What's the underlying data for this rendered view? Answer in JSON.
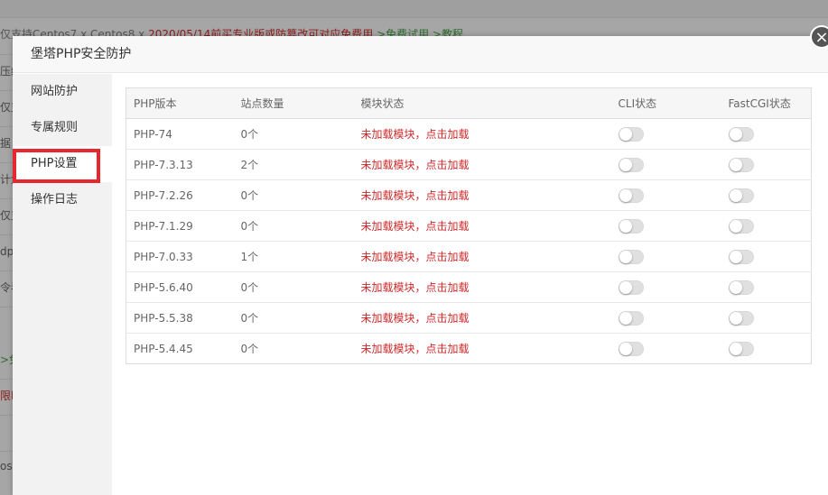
{
  "background": {
    "notice_prefix": "仅支持Centos7 x Centos8 x ",
    "notice_red": "2020/05/14前买专业版或防篡改可对应免费用",
    "notice_green": " >免费试用 >教程",
    "fragments": [
      "压缩",
      "仅支",
      "据",
      "计划",
      "仅支",
      "dp每",
      "令看",
      ">免",
      "限时",
      "os"
    ]
  },
  "modal": {
    "title": "堡塔PHP安全防护",
    "close": "×"
  },
  "sidebar": {
    "items": [
      {
        "label": "网站防护"
      },
      {
        "label": "专属规则"
      },
      {
        "label": "PHP设置"
      },
      {
        "label": "操作日志"
      }
    ]
  },
  "table": {
    "headers": [
      "PHP版本",
      "站点数量",
      "模块状态",
      "CLI状态",
      "FastCGI状态"
    ],
    "rows": [
      {
        "version": "PHP-74",
        "count": "0个",
        "status": "未加载模块，点击加载"
      },
      {
        "version": "PHP-7.3.13",
        "count": "2个",
        "status": "未加载模块，点击加载"
      },
      {
        "version": "PHP-7.2.26",
        "count": "0个",
        "status": "未加载模块，点击加载"
      },
      {
        "version": "PHP-7.1.29",
        "count": "0个",
        "status": "未加载模块，点击加载"
      },
      {
        "version": "PHP-7.0.33",
        "count": "1个",
        "status": "未加载模块，点击加载"
      },
      {
        "version": "PHP-5.6.40",
        "count": "0个",
        "status": "未加载模块，点击加载"
      },
      {
        "version": "PHP-5.5.38",
        "count": "0个",
        "status": "未加载模块，点击加载"
      },
      {
        "version": "PHP-5.4.45",
        "count": "0个",
        "status": "未加载模块，点击加载"
      }
    ]
  }
}
